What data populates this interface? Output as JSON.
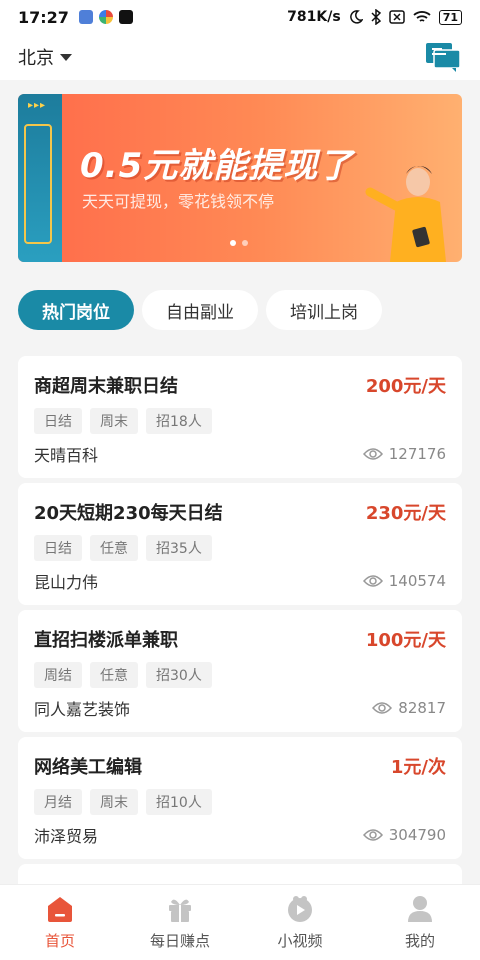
{
  "status": {
    "time": "17:27",
    "speed": "781K/s",
    "battery": "71"
  },
  "header": {
    "city": "北京"
  },
  "banner": {
    "title": "0.5元就能提现了",
    "subtitle": "天天可提现，零花钱领不停",
    "arrows": "▸▸▸"
  },
  "tabs": [
    {
      "label": "热门岗位",
      "active": true
    },
    {
      "label": "自由副业",
      "active": false
    },
    {
      "label": "培训上岗",
      "active": false
    }
  ],
  "jobs": [
    {
      "title": "商超周末兼职日结",
      "pay": "200元/天",
      "tags": [
        "日结",
        "周末",
        "招18人"
      ],
      "company": "天晴百科",
      "views": "127176"
    },
    {
      "title": "20天短期230每天日结",
      "pay": "230元/天",
      "tags": [
        "日结",
        "任意",
        "招35人"
      ],
      "company": "昆山力伟",
      "views": "140574"
    },
    {
      "title": "直招扫楼派单兼职",
      "pay": "100元/天",
      "tags": [
        "周结",
        "任意",
        "招30人"
      ],
      "company": "同人嘉艺装饰",
      "views": "82817"
    },
    {
      "title": "网络美工编辑",
      "pay": "1元/次",
      "tags": [
        "月结",
        "周末",
        "招10人"
      ],
      "company": "沛泽贸易",
      "views": "304790"
    }
  ],
  "nav": [
    {
      "label": "首页",
      "icon": "home-icon",
      "active": true
    },
    {
      "label": "每日赚点",
      "icon": "gift-icon",
      "active": false
    },
    {
      "label": "小视频",
      "icon": "video-icon",
      "active": false
    },
    {
      "label": "我的",
      "icon": "user-icon",
      "active": false
    }
  ],
  "colors": {
    "accent": "#1a8aa6",
    "pay": "#d8472c",
    "nav_active": "#e8553a"
  }
}
